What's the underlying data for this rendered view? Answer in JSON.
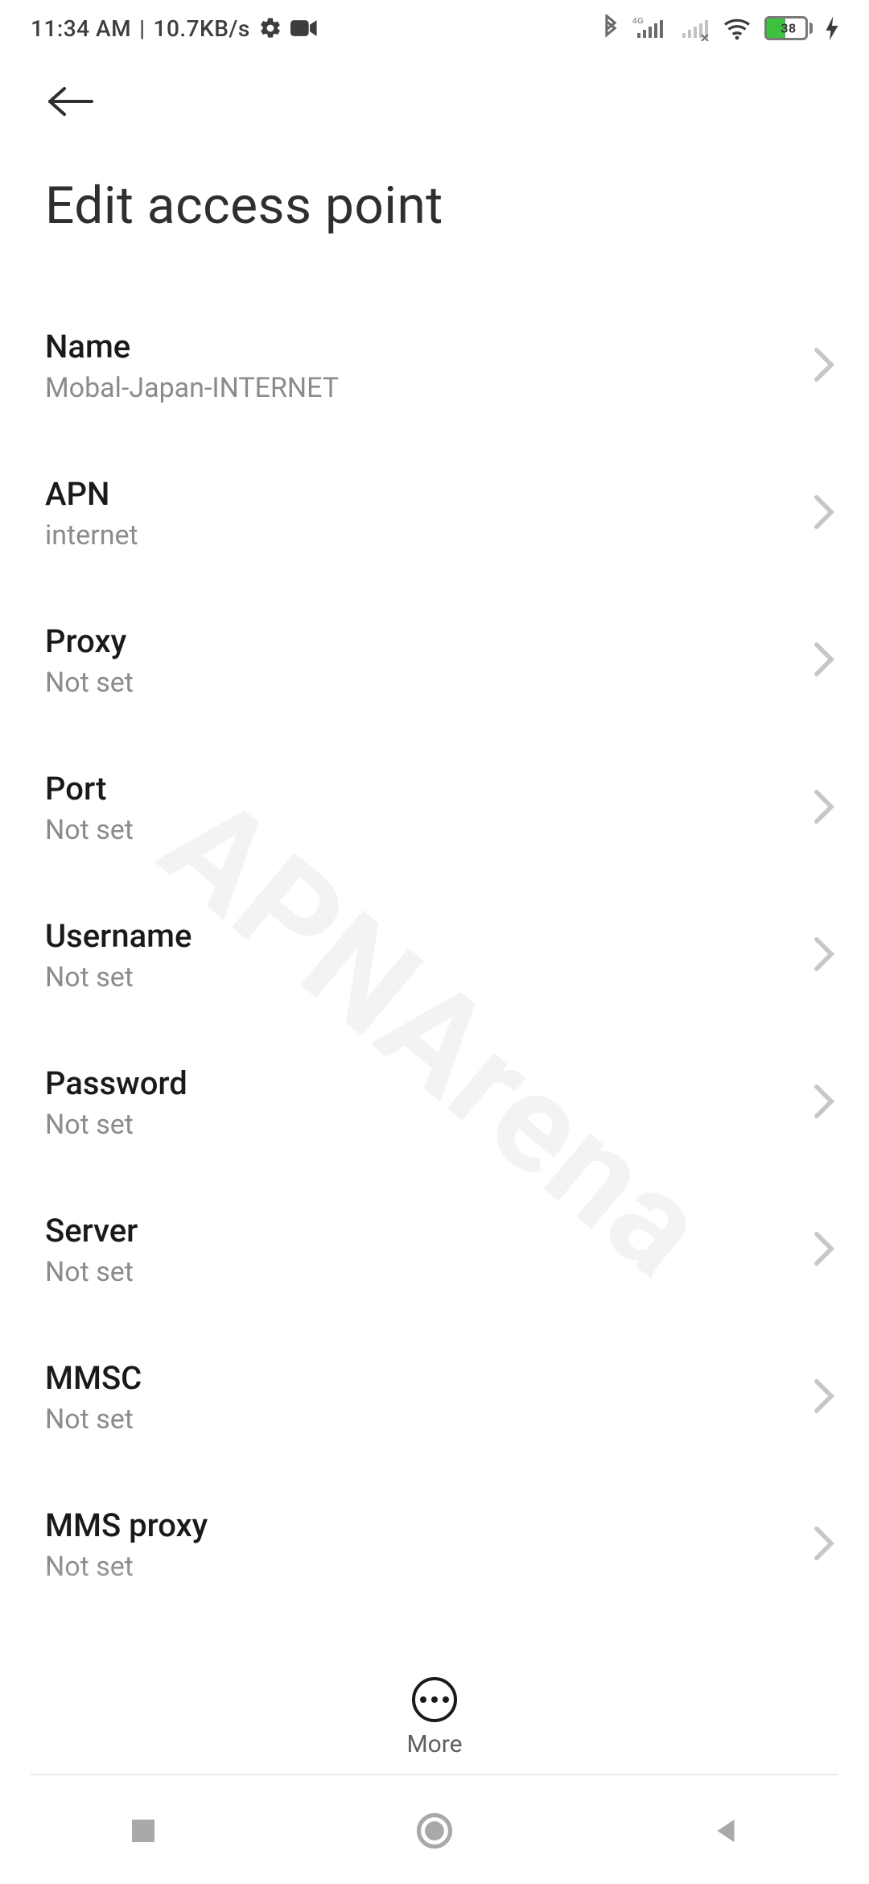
{
  "status": {
    "time": "11:34 AM",
    "separator": "|",
    "network_speed": "10.7KB/s",
    "battery_percent": "38"
  },
  "page": {
    "title": "Edit access point"
  },
  "settings": {
    "name": {
      "label": "Name",
      "value": "Mobal-Japan-INTERNET"
    },
    "apn": {
      "label": "APN",
      "value": "internet"
    },
    "proxy": {
      "label": "Proxy",
      "value": "Not set"
    },
    "port": {
      "label": "Port",
      "value": "Not set"
    },
    "username": {
      "label": "Username",
      "value": "Not set"
    },
    "password": {
      "label": "Password",
      "value": "Not set"
    },
    "server": {
      "label": "Server",
      "value": "Not set"
    },
    "mmsc": {
      "label": "MMSC",
      "value": "Not set"
    },
    "mms_proxy": {
      "label": "MMS proxy",
      "value": "Not set"
    }
  },
  "footer": {
    "more_label": "More"
  },
  "watermark": "APNArena"
}
